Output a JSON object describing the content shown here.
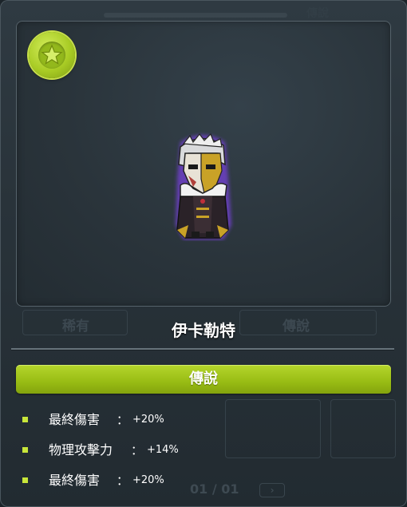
{
  "background": {
    "left_tab": "稀有",
    "right_tab": "傳說",
    "top_right_text": "傳說",
    "pager": {
      "current": "01",
      "separator": "/",
      "total": "01"
    }
  },
  "card": {
    "badge_icon": "star-icon",
    "character_name": "伊卡勒特",
    "grade_label": "傳說",
    "grade_color": "#9cc21a",
    "stats": [
      {
        "name": "最終傷害",
        "sep": "：",
        "value": "+20%"
      },
      {
        "name": "物理攻擊力",
        "sep": "：",
        "value": "+14%"
      },
      {
        "name": "最終傷害",
        "sep": "：",
        "value": "+20%"
      }
    ]
  }
}
